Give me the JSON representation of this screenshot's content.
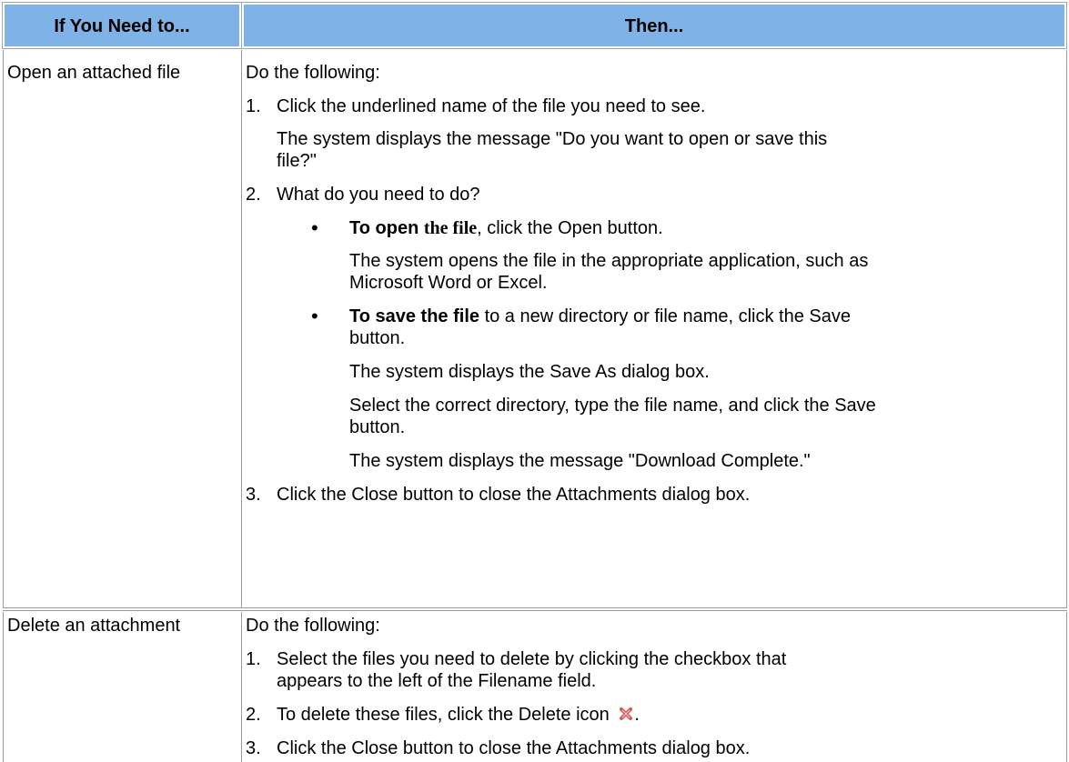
{
  "header": {
    "col1": "If You Need to...",
    "col2": "Then..."
  },
  "rows": [
    {
      "action": "Open an attached file",
      "intro": "Do the following:",
      "step1": "Click the underlined name of the file you need to see.",
      "step1_note_a": "The system displays the message \"Do you want to open or save this",
      "step1_note_b": "file?\"",
      "step2": "What do you need to do?",
      "bullet1_bold_a": "To open ",
      "bullet1_bold_b": "the file",
      "bullet1_rest": ", click the Open button.",
      "bullet1_note_a": "The system opens the file in the appropriate application, such as",
      "bullet1_note_b": "Microsoft Word or Excel.",
      "bullet2_bold": "To save the file",
      "bullet2_rest": " to a new directory or file name, click the Save",
      "bullet2_rest_b": "button.",
      "bullet2_note1": "The system displays the Save As dialog box.",
      "bullet2_note2_a": "Select the correct directory, type the file name, and click the Save",
      "bullet2_note2_b": "button.",
      "bullet2_note3": "The system displays the message \"Download Complete.\"",
      "step3": "Click the Close button to close the Attachments dialog box.",
      "n1": "1.",
      "n2": "2.",
      "n3": "3.",
      "bullet": "•"
    },
    {
      "action": "Delete an attachment",
      "intro": "Do the following:",
      "step1_a": "Select the files you need to delete by clicking the checkbox that",
      "step1_b": "appears to the left of the Filename field.",
      "step2_pre": "To delete these files, click the Delete icon",
      "step2_post": ".",
      "step3": "Click the Close button to close the Attachments dialog box.",
      "n1": "1.",
      "n2": "2.",
      "n3": "3.",
      "delete_icon": "delete-x-icon",
      "delete_color": "#d9534f"
    }
  ],
  "colors": {
    "header_bg": "#7fb2e6",
    "border": "#9a9a9a"
  }
}
